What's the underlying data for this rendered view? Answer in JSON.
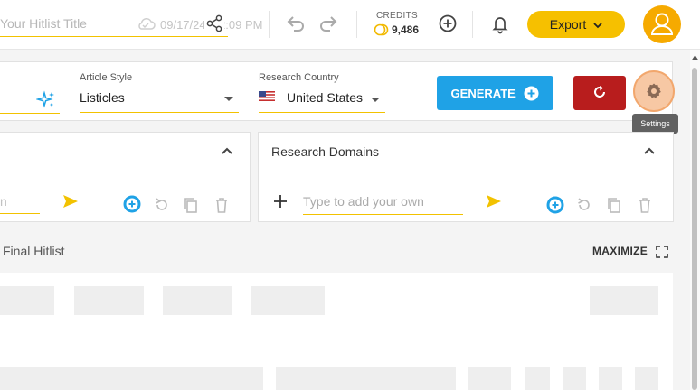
{
  "header": {
    "title_placeholder": "Your Hitlist Title",
    "saved_date": "09/17/24, 12:09 PM",
    "credits_label": "CREDITS",
    "credits_value": "9,486",
    "export_label": "Export"
  },
  "settings": {
    "article_style_label": "Article Style",
    "article_style_value": "Listicles",
    "research_country_label": "Research Country",
    "research_country_value": "United States",
    "generate_label": "GENERATE",
    "settings_tooltip": "Settings"
  },
  "left_panel": {
    "input_partial": "n"
  },
  "domains_panel": {
    "title": "Research Domains",
    "input_placeholder": "Type to add your own"
  },
  "hitlist": {
    "title": "Final Hitlist",
    "maximize_label": "MAXIMIZE"
  },
  "colors": {
    "accent_yellow": "#f6c000",
    "generate_blue": "#1fa2e6",
    "reset_red": "#b81d1d",
    "avatar_orange": "#f6aa00"
  },
  "icons": {
    "cloud": "cloud-icon",
    "share": "share-icon",
    "undo": "undo-icon",
    "redo": "redo-icon",
    "coin": "coin-icon",
    "add_credits": "add-circle-icon",
    "bell": "bell-icon",
    "avatar": "user-icon",
    "sparkle": "sparkle-icon",
    "flag": "us-flag-icon",
    "reset": "refresh-icon",
    "settings": "gear-icon",
    "add": "plus-icon",
    "send": "send-icon",
    "copy": "copy-icon",
    "delete": "trash-icon",
    "maximize": "maximize-icon"
  }
}
